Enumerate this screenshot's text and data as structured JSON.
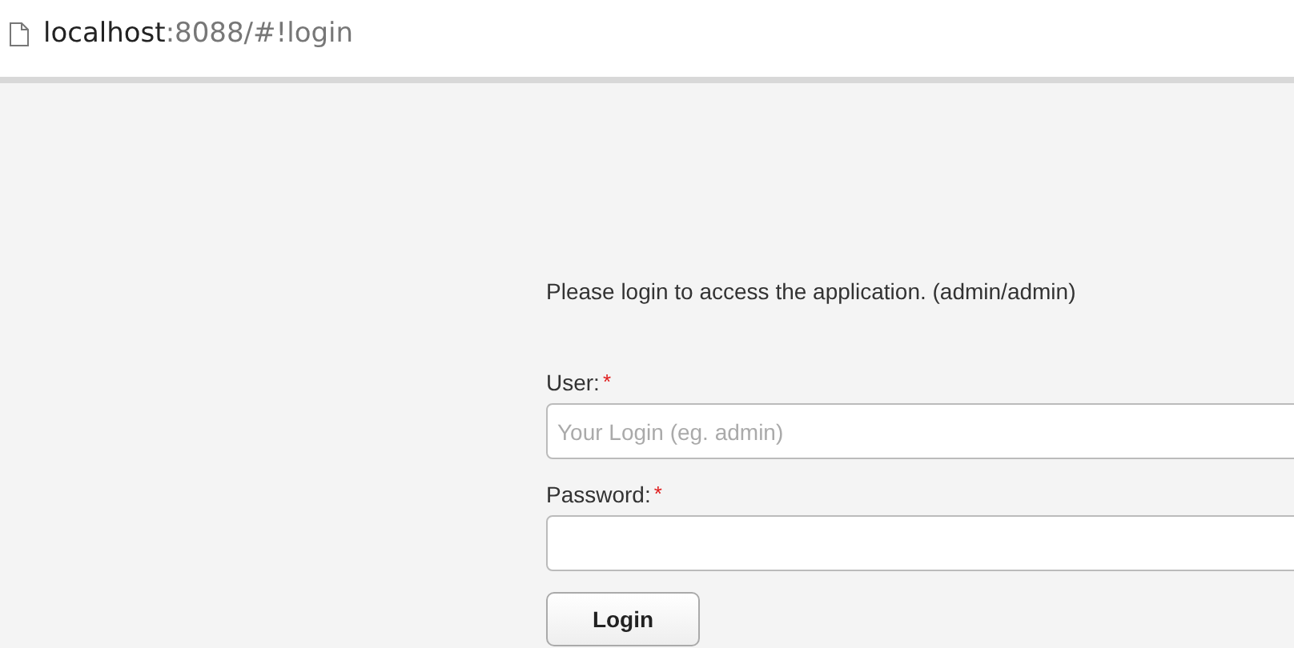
{
  "address_bar": {
    "host": "localhost",
    "path": ":8088/#!login"
  },
  "login_form": {
    "message": "Please login to access the application. (admin/admin)",
    "fields": [
      {
        "label": "User:",
        "required_mark": "*",
        "placeholder": "Your Login (eg. admin)"
      },
      {
        "label": "Password:",
        "required_mark": "*"
      }
    ],
    "button": "Login"
  }
}
